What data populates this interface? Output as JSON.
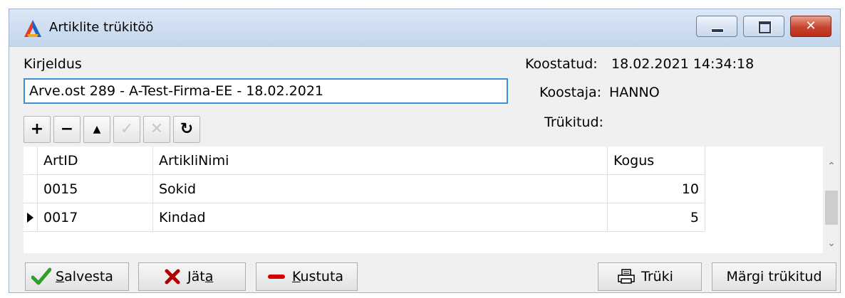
{
  "window": {
    "title": "Artiklite trükitöö",
    "controls": {
      "minimize": "minimize",
      "maximize": "maximize",
      "close": "✕"
    }
  },
  "form": {
    "description_label": "Kirjeldus",
    "description_value": "Arve.ost 289 - A-Test-Firma-EE - 18.02.2021",
    "created_label": "Koostatud:",
    "created_value": "18.02.2021 14:34:18",
    "author_label": "Koostaja:",
    "author_value": "HANNO",
    "printed_label": "Trükitud:",
    "printed_value": ""
  },
  "toolbar": {
    "add": "+",
    "remove": "−",
    "up": "▲",
    "confirm": "✓",
    "cancel": "✕",
    "refresh": "↻"
  },
  "grid": {
    "columns": [
      "ArtID",
      "ArtikliNimi",
      "Kogus"
    ],
    "rows": [
      {
        "id": "0015",
        "name": "Sokid",
        "qty": "10"
      },
      {
        "id": "0017",
        "name": "Kindad",
        "qty": "5"
      }
    ],
    "current_row_index": 1
  },
  "buttons": {
    "save": {
      "key": "S",
      "rest": "alvesta"
    },
    "discard": {
      "pre": "Jät",
      "key": "a",
      "post": ""
    },
    "delete": {
      "key": "K",
      "rest": "ustuta"
    },
    "print": "Trüki",
    "mark_printed": "Märgi trükitud"
  },
  "colors": {
    "titlebar": "#c3d6ec",
    "input_focus_border": "#3c8fd6",
    "save_check": "#2e9e2e",
    "discard_x": "#b00000",
    "delete_bar": "#d40000",
    "close_button": "#c8432e"
  }
}
